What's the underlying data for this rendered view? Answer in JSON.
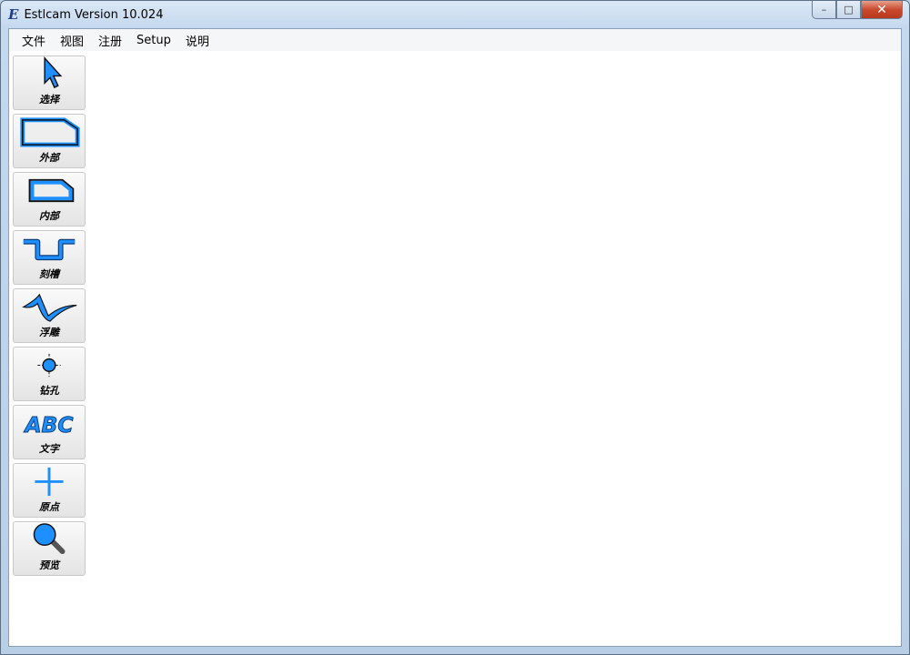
{
  "window": {
    "title": "Estlcam Version 10.024",
    "logo": "E",
    "minimize": "–",
    "maximize": "□",
    "close": "✕"
  },
  "menu": [
    "文件",
    "视图",
    "注册",
    "Setup",
    "说明"
  ],
  "tools": [
    {
      "label": "选择",
      "icon": "arrow-icon"
    },
    {
      "label": "外部",
      "icon": "outside-shape-icon"
    },
    {
      "label": "内部",
      "icon": "inside-shape-icon"
    },
    {
      "label": "刻槽",
      "icon": "groove-icon"
    },
    {
      "label": "浮雕",
      "icon": "relief-icon"
    },
    {
      "label": "钻孔",
      "icon": "drill-icon"
    },
    {
      "label": "文字",
      "icon": "text-icon",
      "glyph": "ABC"
    },
    {
      "label": "原点",
      "icon": "origin-icon"
    },
    {
      "label": "预览",
      "icon": "magnifier-icon"
    }
  ],
  "colors": {
    "accent": "#1e8fff"
  }
}
